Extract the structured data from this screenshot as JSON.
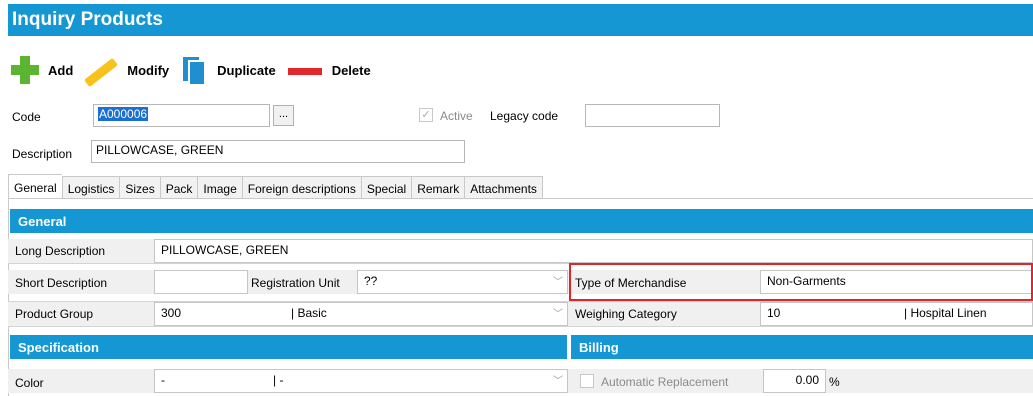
{
  "window": {
    "title": "Inquiry Products"
  },
  "toolbar": {
    "add_label": "Add",
    "modify_label": "Modify",
    "duplicate_label": "Duplicate",
    "delete_label": "Delete"
  },
  "header": {
    "code_label": "Code",
    "code_value": "A000006",
    "code_lookup": "...",
    "active_label": "Active",
    "active_checked": true,
    "legacy_label": "Legacy code",
    "legacy_value": "",
    "description_label": "Description",
    "description_value": "PILLOWCASE, GREEN"
  },
  "tabs": [
    {
      "label": "General",
      "active": true
    },
    {
      "label": "Logistics"
    },
    {
      "label": "Sizes"
    },
    {
      "label": "Pack"
    },
    {
      "label": "Image"
    },
    {
      "label": "Foreign descriptions"
    },
    {
      "label": "Special"
    },
    {
      "label": "Remark"
    },
    {
      "label": "Attachments"
    }
  ],
  "general": {
    "section_title": "General",
    "long_desc_label": "Long Description",
    "long_desc_value": "PILLOWCASE, GREEN",
    "short_desc_label": "Short Description",
    "short_desc_value": "",
    "reg_unit_label": "Registration Unit",
    "reg_unit_value": "??",
    "merch_type_label": "Type of Merchandise",
    "merch_type_value": "Non-Garments",
    "product_group_label": "Product Group",
    "product_group_code": "300",
    "product_group_name": "| Basic",
    "weighing_label": "Weighing Category",
    "weighing_code": "10",
    "weighing_name": "| Hospital Linen"
  },
  "specification": {
    "section_title": "Specification",
    "color_label": "Color",
    "color_code": "-",
    "color_name": "| -"
  },
  "billing": {
    "section_title": "Billing",
    "auto_replace_label": "Automatic Replacement",
    "auto_replace_checked": false,
    "percent_value": "0.00",
    "percent_unit": "%"
  },
  "colors": {
    "accent": "#1497d3",
    "highlight_border": "#e0262c",
    "add_icon": "#5cb531",
    "modify_icon": "#f7c21c",
    "delete_icon": "#e1282d"
  }
}
